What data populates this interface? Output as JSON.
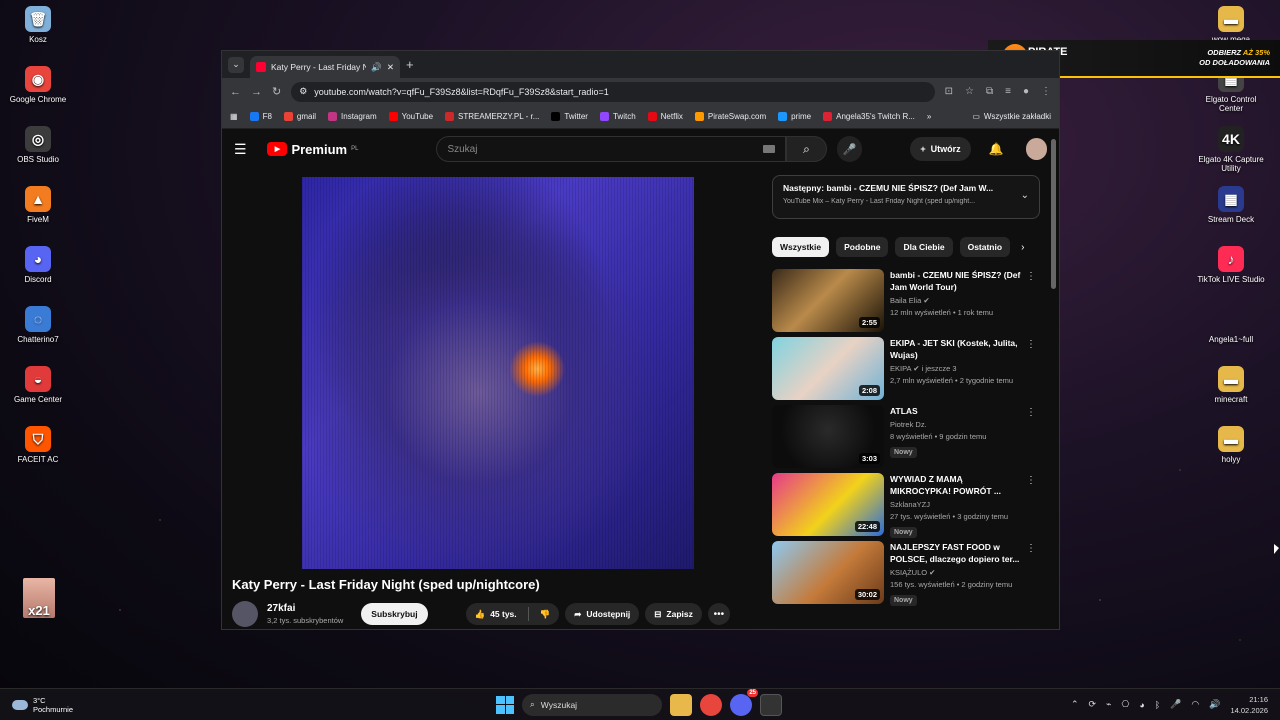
{
  "desktop_left": [
    {
      "label": "Kosz",
      "color": "#7fb0d9",
      "glyph": "🗑"
    },
    {
      "label": "Google Chrome",
      "color": "#e8453c",
      "glyph": "◉"
    },
    {
      "label": "OBS Studio",
      "color": "#3c3c3c",
      "glyph": "◎"
    },
    {
      "label": "FiveM",
      "color": "#f47c20",
      "glyph": "▲"
    },
    {
      "label": "Discord",
      "color": "#5865f2",
      "glyph": "◕"
    },
    {
      "label": "Chatterino7",
      "color": "#3a7bd5",
      "glyph": "◌"
    },
    {
      "label": "Game Center",
      "color": "#e03a3a",
      "glyph": "◒"
    },
    {
      "label": "FACEIT AC",
      "color": "#ff5500",
      "glyph": "⛉"
    }
  ],
  "desktop_right": [
    {
      "label": "wow mega",
      "color": "#e6b84a",
      "glyph": "▬"
    },
    {
      "label": "Elgato Control Center",
      "color": "#444",
      "glyph": "▦"
    },
    {
      "label": "Elgato 4K Capture Utility",
      "color": "#222",
      "glyph": "4K"
    },
    {
      "label": "Stream Deck",
      "color": "#2a3b8f",
      "glyph": "▦"
    },
    {
      "label": "TikTok LIVE Studio",
      "color": "#fe2c55",
      "glyph": "♪"
    },
    {
      "label": "Angela1~full",
      "color": "transparent",
      "glyph": ""
    },
    {
      "label": "minecraft",
      "color": "#e6b84a",
      "glyph": "▬"
    },
    {
      "label": "holyy",
      "color": "#e6b84a",
      "glyph": "▬"
    }
  ],
  "desktop_x21": "x21",
  "browser": {
    "tab_title": "Katy Perry - Last Friday Night",
    "url": "youtube.com/watch?v=qfFu_F39Sz8&list=RDqfFu_F39Sz8&start_radio=1",
    "bookmarks": [
      {
        "label": "F8",
        "color": "#1877f2"
      },
      {
        "label": "gmail",
        "color": "#ea4335"
      },
      {
        "label": "Instagram",
        "color": "#c13584"
      },
      {
        "label": "YouTube",
        "color": "#ff0000"
      },
      {
        "label": "STREAMERZY.PL - r...",
        "color": "#cc2a2a"
      },
      {
        "label": "Twitter",
        "color": "#000000"
      },
      {
        "label": "Twitch",
        "color": "#9146ff"
      },
      {
        "label": "Netflix",
        "color": "#e50914"
      },
      {
        "label": "PirateSwap.com",
        "color": "#ff9900"
      },
      {
        "label": "prime",
        "color": "#1a98ff"
      },
      {
        "label": "Angela35's Twitch R...",
        "color": "#d23"
      }
    ],
    "all_bookmarks": "Wszystkie zakładki"
  },
  "youtube": {
    "logo_text": "Premium",
    "logo_region": "PL",
    "search_placeholder": "Szukaj",
    "create_label": "Utwórz",
    "video_title": "Katy Perry - Last Friday Night (sped up/nightcore)",
    "channel_name": "27kfai",
    "channel_subs": "3,2 tys. subskrybentów",
    "subscribe_label": "Subskrybuj",
    "likes": "45 tys.",
    "share_label": "Udostępnij",
    "save_label": "Zapisz",
    "next_line1": "Następny: bambi - CZEMU NIE ŚPISZ? (Def Jam W...",
    "next_line2": "YouTube Mix – Katy Perry - Last Friday Night (sped up/night...",
    "chips": [
      "Wszystkie",
      "Podobne",
      "Dla Ciebie",
      "Ostatnio"
    ],
    "recommendations": [
      {
        "title": "bambi - CZEMU NIE ŚPISZ? (Def Jam World Tour)",
        "channel": "Baila Elia",
        "verified": true,
        "meta": "12 mln wyświetleń • 1 rok temu",
        "duration": "2:55",
        "new": false,
        "thumb": "linear-gradient(135deg,#3a2a1a,#b98a4a 45%,#1a1208)"
      },
      {
        "title": "EKIPA - JET SKI (Kostek, Julita, Wujas)",
        "channel": "EKIPA",
        "verified": true,
        "channel_extra": "i jeszcze 3",
        "meta": "2,7 mln wyświetleń • 2 tygodnie temu",
        "duration": "2:08",
        "new": false,
        "thumb": "linear-gradient(135deg,#7fd3e0,#e8d2c4 50%,#6fb2d6)"
      },
      {
        "title": "ATLAS",
        "channel": "Piotrek Dz.",
        "verified": false,
        "meta": "8 wyświetleń • 9 godzin temu",
        "duration": "3:03",
        "new": true,
        "thumb": "radial-gradient(circle at 50% 40%,#2a2a2a,#0c0c0c 70%)"
      },
      {
        "title": "WYWIAD Z MAMĄ MIKROCYPKA! POWRÓT ...",
        "channel": "SzklanaYZJ",
        "verified": false,
        "meta": "27 tys. wyświetleń • 3 godziny temu",
        "duration": "22:48",
        "new": true,
        "thumb": "linear-gradient(135deg,#e63a8a,#f2d21b 55%,#2b6bd8)"
      },
      {
        "title": "NAJLEPSZY FAST FOOD w POLSCE, dlaczego dopiero ter...",
        "channel": "KSIĄŻULO",
        "verified": true,
        "meta": "156 tys. wyświetleń • 2 godziny temu",
        "duration": "30:02",
        "new": true,
        "thumb": "linear-gradient(135deg,#8ec9f0,#c47a3a 55%,#6a3a1a)"
      }
    ],
    "new_badge": "Nowy"
  },
  "ad": {
    "brand_line1": "PIRATE",
    "brand_line2": "SWAP",
    "promo_line1_a": "ODBIERZ ",
    "promo_line1_b": "AŻ 35%",
    "promo_line2": "OD DOŁADOWANIA"
  },
  "taskbar": {
    "temp": "3°C",
    "weather": "Pochmurnie",
    "search_label": "Wyszukaj",
    "time": "21:16",
    "date": "14.02.2026",
    "discord_badge": "25"
  }
}
